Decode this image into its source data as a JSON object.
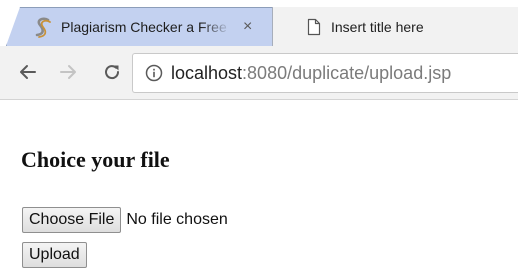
{
  "browser": {
    "tabs": [
      {
        "title": "Plagiarism Checker a Free",
        "close_glyph": "×",
        "icon": "plagiarism-s-logo-icon"
      },
      {
        "title": "Insert title here",
        "icon": "blank-page-icon"
      }
    ],
    "nav": {
      "back_glyph": "←",
      "forward_glyph": "→",
      "reload_icon": "reload-icon"
    },
    "address": {
      "host": "localhost",
      "rest": ":8080/duplicate/upload.jsp",
      "info_icon": "info-icon"
    }
  },
  "page": {
    "heading": "Choice your file",
    "choose_file_label": "Choose File",
    "no_file_text": "No file chosen",
    "upload_label": "Upload"
  },
  "colors": {
    "inactive_tab": "#c3d1f0",
    "active_tab": "#f2f2f2",
    "page_background": "#ffffff"
  }
}
